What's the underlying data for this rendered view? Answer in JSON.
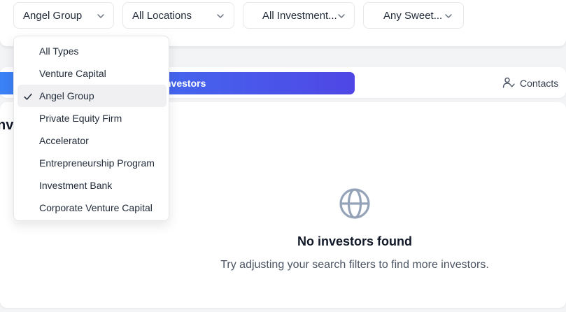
{
  "filters": {
    "type": {
      "value": "Angel Group"
    },
    "location": {
      "value": "All Locations"
    },
    "investment": {
      "value": "All Investment..."
    },
    "sweet_spot": {
      "value": "Any Sweet..."
    }
  },
  "dropdown": {
    "selected": "Angel Group",
    "items": [
      {
        "label": "All Types"
      },
      {
        "label": "Venture Capital"
      },
      {
        "label": "Angel Group",
        "selected": true
      },
      {
        "label": "Private Equity Firm"
      },
      {
        "label": "Accelerator"
      },
      {
        "label": "Entrepreneurship Program"
      },
      {
        "label": "Investment Bank"
      },
      {
        "label": "Corporate Venture Capital"
      }
    ]
  },
  "tabs": {
    "active_label": "nvestors",
    "contacts_label": "Contacts"
  },
  "section": {
    "heading": "nv"
  },
  "empty_state": {
    "icon": "globe-icon",
    "title": "No investors found",
    "message": "Try adjusting your search filters to find more investors."
  },
  "colors": {
    "accent_start": "#3b82f6",
    "accent_end": "#4f46e5",
    "icon_gray": "#94a3b8"
  }
}
